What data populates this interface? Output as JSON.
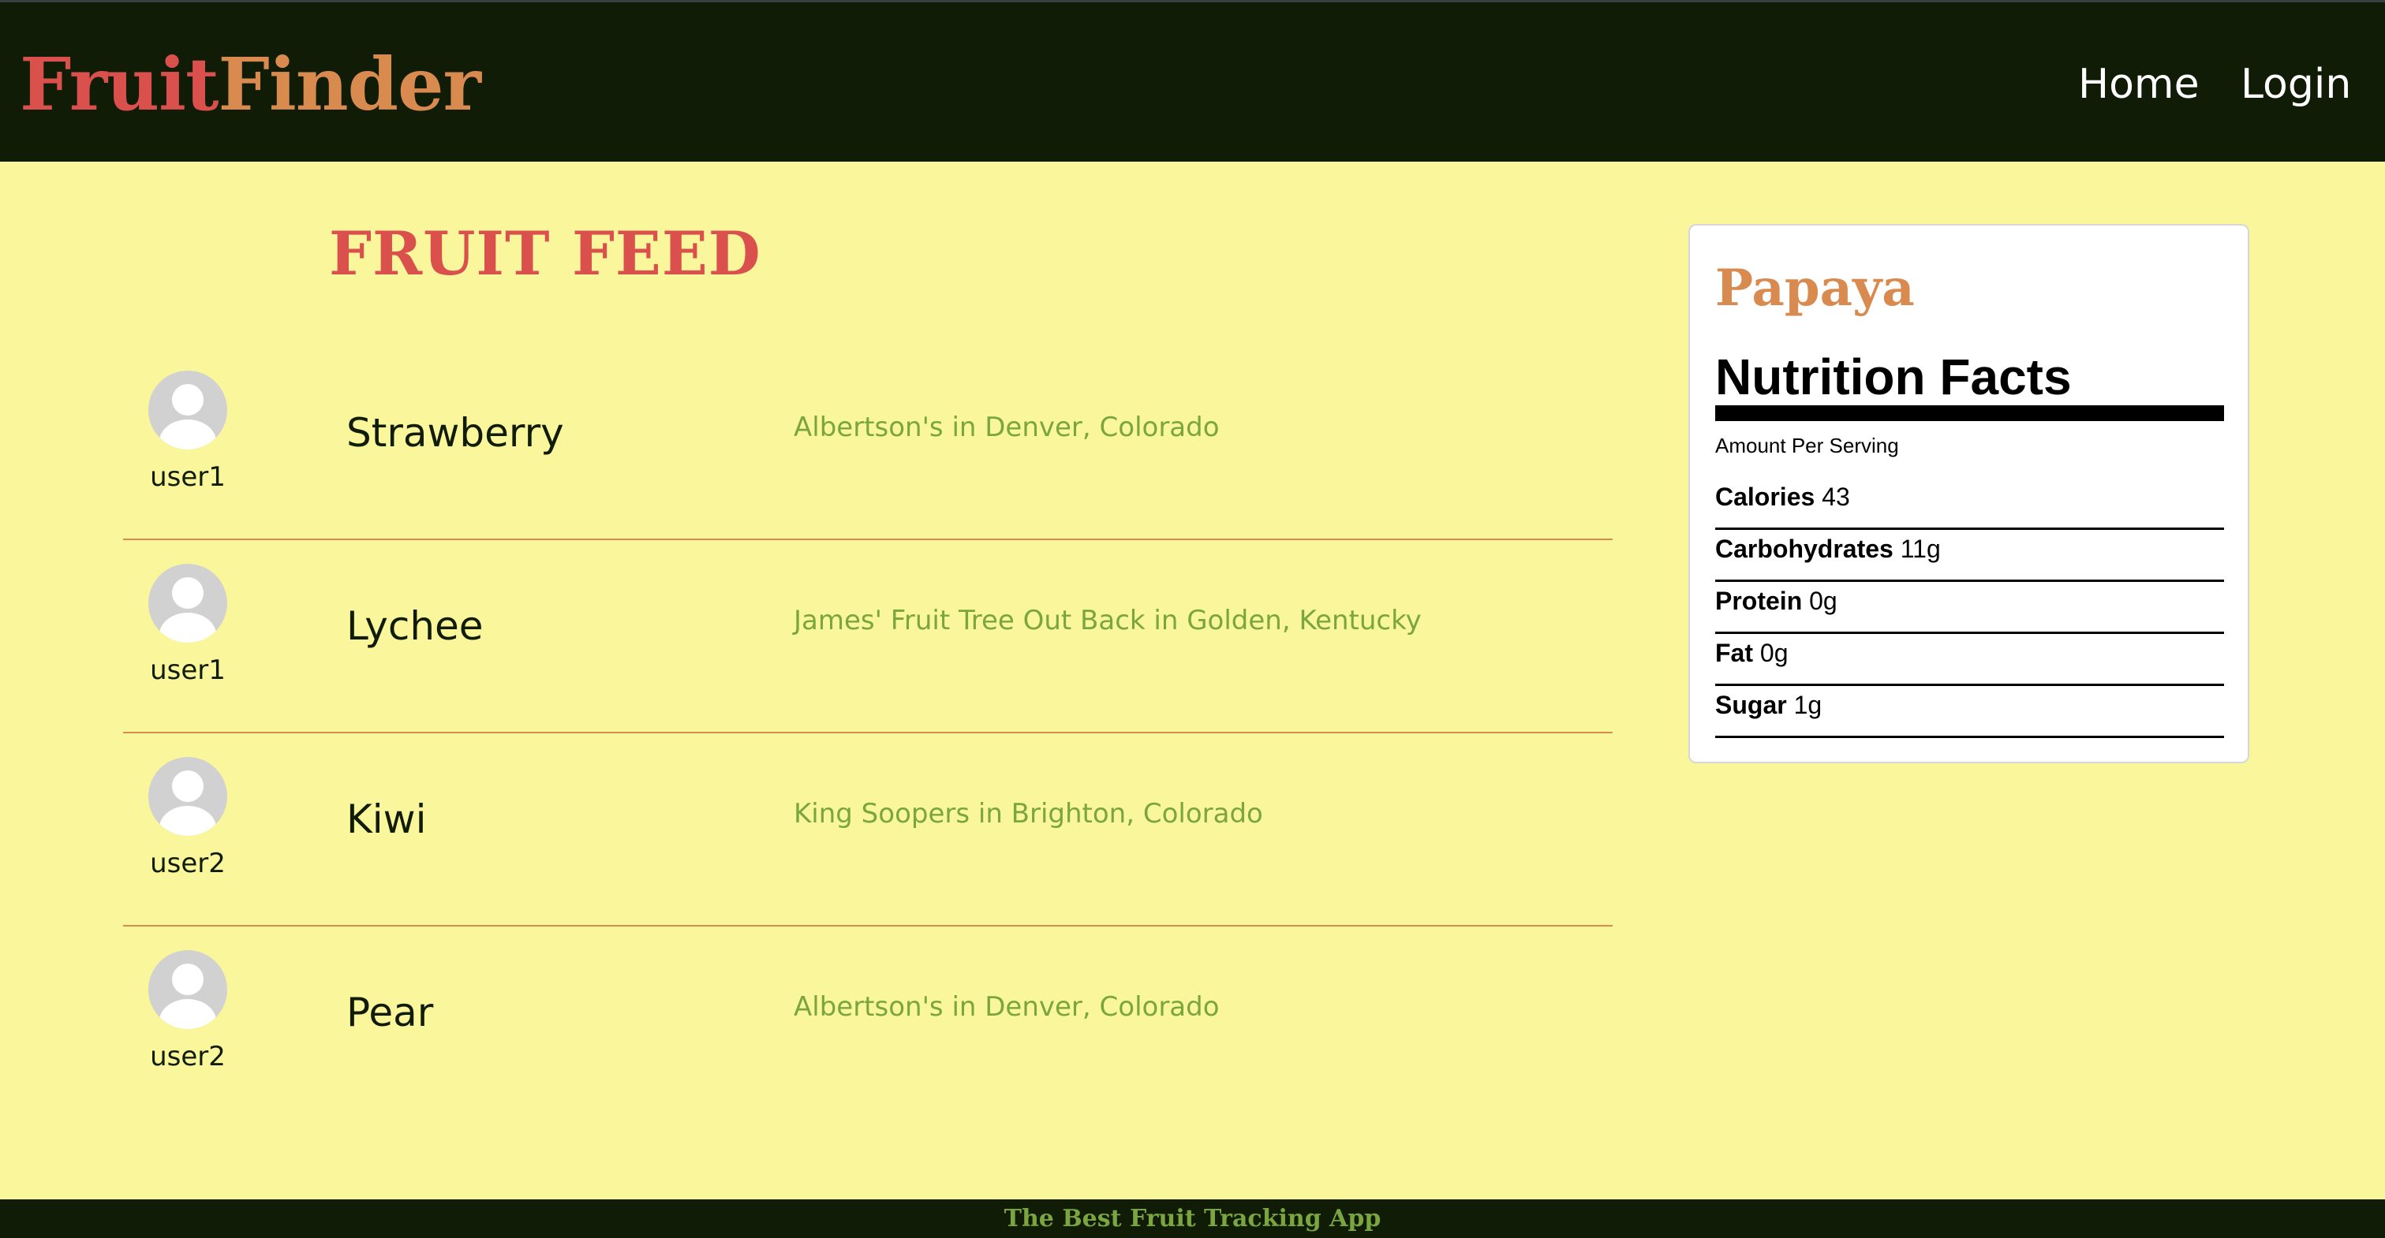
{
  "header": {
    "logo_part1": "Fruit",
    "logo_part2": "Finder",
    "nav": {
      "home": "Home",
      "login": "Login"
    }
  },
  "feed": {
    "title": "FRUIT FEED",
    "items": [
      {
        "user": "user1",
        "fruit": "Strawberry",
        "location": "Albertson's in Denver, Colorado"
      },
      {
        "user": "user1",
        "fruit": "Lychee",
        "location": "James' Fruit Tree Out Back in Golden, Kentucky"
      },
      {
        "user": "user2",
        "fruit": "Kiwi",
        "location": "King Soopers in Brighton, Colorado"
      },
      {
        "user": "user2",
        "fruit": "Pear",
        "location": "Albertson's in Denver, Colorado"
      }
    ]
  },
  "nutrition": {
    "fruit": "Papaya",
    "title": "Nutrition Facts",
    "serving_label": "Amount Per Serving",
    "rows": [
      {
        "label": "Calories",
        "value": "43"
      },
      {
        "label": "Carbohydrates",
        "value": "11g"
      },
      {
        "label": "Protein",
        "value": "0g"
      },
      {
        "label": "Fat",
        "value": "0g"
      },
      {
        "label": "Sugar",
        "value": "1g"
      }
    ]
  },
  "footer": {
    "tagline": "The Best Fruit Tracking App"
  },
  "colors": {
    "background": "#faf69c",
    "navbar": "#111c07",
    "brand_red": "#d9504c",
    "brand_orange": "#d88a4f",
    "location_green": "#7ba63f"
  },
  "icons": {
    "avatar": "user-avatar-icon"
  }
}
